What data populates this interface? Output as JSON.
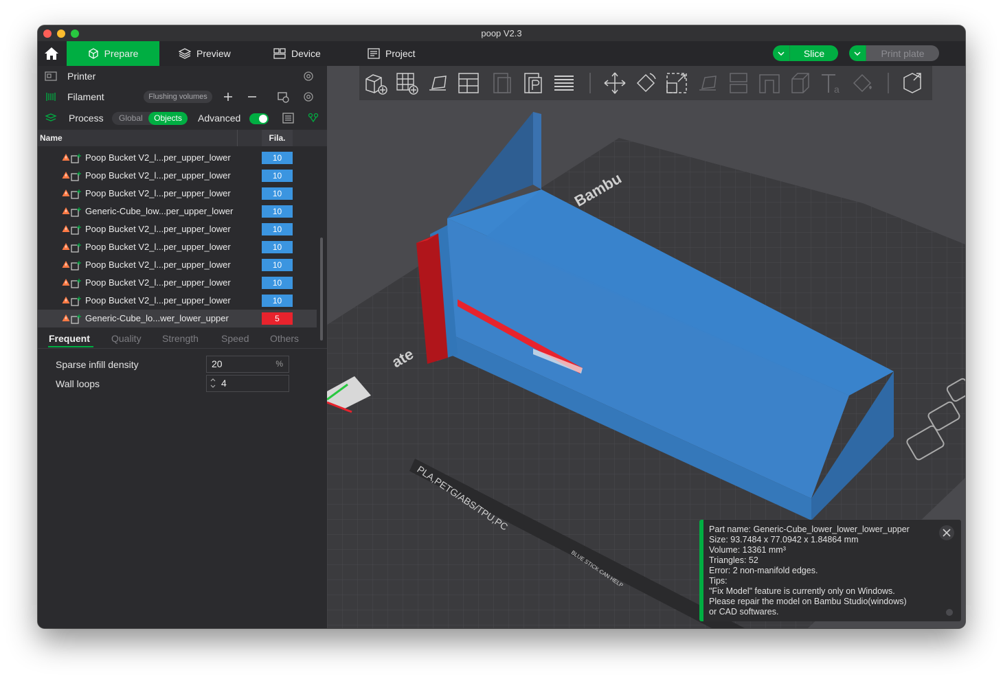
{
  "window": {
    "title": "poop V2.3"
  },
  "topbar": {
    "tabs": [
      {
        "label": "Prepare",
        "active": true
      },
      {
        "label": "Preview"
      },
      {
        "label": "Device"
      },
      {
        "label": "Project"
      }
    ],
    "slice_label": "Slice",
    "print_label": "Print plate"
  },
  "sidebar": {
    "printer_label": "Printer",
    "filament_label": "Filament",
    "flushing_label": "Flushing volumes",
    "process_label": "Process",
    "global_label": "Global",
    "objects_label": "Objects",
    "advanced_label": "Advanced",
    "advanced_on": true
  },
  "table": {
    "col_name": "Name",
    "col_fila": "Fila.",
    "rows": [
      {
        "name": "Poop Bucket V2_l...per_upper_lower",
        "fila": "10",
        "color": "#3b95e0"
      },
      {
        "name": "Poop Bucket V2_l...per_upper_lower",
        "fila": "10",
        "color": "#3b95e0"
      },
      {
        "name": "Poop Bucket V2_l...per_upper_lower",
        "fila": "10",
        "color": "#3b95e0"
      },
      {
        "name": "Generic-Cube_low...per_upper_lower",
        "fila": "10",
        "color": "#3b95e0"
      },
      {
        "name": "Poop Bucket V2_l...per_upper_lower",
        "fila": "10",
        "color": "#3b95e0"
      },
      {
        "name": "Poop Bucket V2_l...per_upper_lower",
        "fila": "10",
        "color": "#3b95e0"
      },
      {
        "name": "Poop Bucket V2_l...per_upper_lower",
        "fila": "10",
        "color": "#3b95e0"
      },
      {
        "name": "Poop Bucket V2_l...per_upper_lower",
        "fila": "10",
        "color": "#3b95e0"
      },
      {
        "name": "Poop Bucket V2_l...per_upper_lower",
        "fila": "10",
        "color": "#3b95e0"
      },
      {
        "name": "Generic-Cube_lo...wer_lower_upper",
        "fila": "5",
        "color": "#e8232d",
        "selected": true
      }
    ]
  },
  "settings_tabs": [
    "Frequent",
    "Quality",
    "Strength",
    "Speed",
    "Others"
  ],
  "params": {
    "sparse_infill_label": "Sparse infill density",
    "sparse_infill_value": "20",
    "sparse_infill_unit": "%",
    "wall_loops_label": "Wall loops",
    "wall_loops_value": "4"
  },
  "plate": {
    "brand_text": "Bambu",
    "label_text": "PLA,PETG/ABS/TPU,PC",
    "plate_text": "ate",
    "glue_text": "BLUE STICK CAN HELP"
  },
  "info": {
    "part_name": "Part name: Generic-Cube_lower_lower_lower_upper",
    "size": "Size: 93.7484 x 77.0942 x 1.84864 mm",
    "volume": "Volume: 13361 mm³",
    "triangles": "Triangles: 52",
    "error": "Error: 2 non-manifold edges.",
    "tips": "Tips:",
    "tip1": "\"Fix Model\" feature is currently only on Windows.",
    "tip2": "Please repair the model on Bambu Studio(windows)",
    "tip3": "or CAD softwares."
  },
  "colors": {
    "accent": "#00ae42",
    "filament_blue": "#3b95e0",
    "filament_red": "#e8232d"
  }
}
